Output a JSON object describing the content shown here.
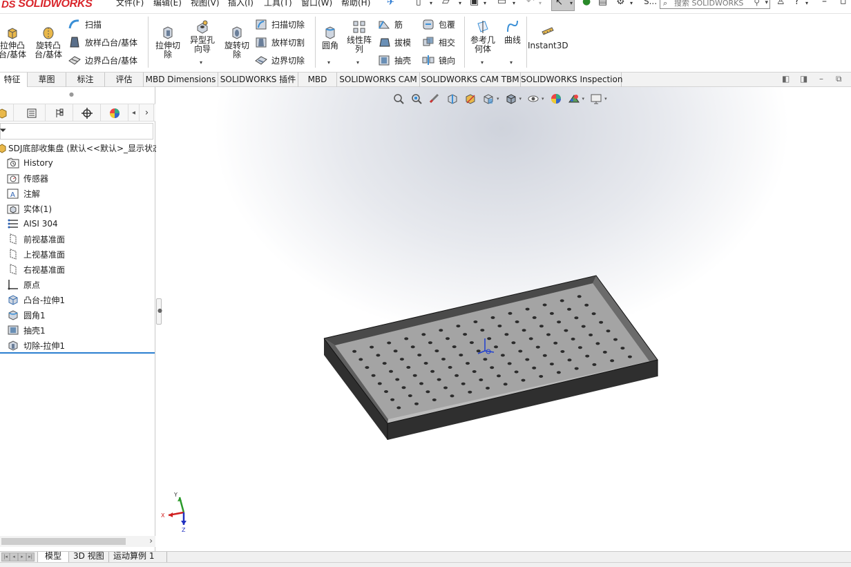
{
  "app": {
    "logo_text": "SOLIDWORKS",
    "logo_prefix": "DS"
  },
  "menu": [
    "文件(F)",
    "编辑(E)",
    "视图(V)",
    "插入(I)",
    "工具(T)",
    "窗口(W)",
    "帮助(H)"
  ],
  "search": {
    "placeholder": "搜索 SOLIDWORKS",
    "visible_text": "搜索 SOLIDWORKS"
  },
  "quick_access": {
    "truncated_label": "S..."
  },
  "commands": {
    "extrude_boss": "拉伸凸\n台/基体",
    "revolve_boss": "旋转凸\n台/基体",
    "sweep": "扫描",
    "loft_boss": "放样凸台/基体",
    "boundary_boss": "边界凸台/基体",
    "extrude_cut": "拉伸切\n除",
    "hole_wizard": "异型孔\n向导",
    "revolve_cut": "旋转切\n除",
    "sweep_cut": "扫描切除",
    "loft_cut": "放样切割",
    "boundary_cut": "边界切除",
    "fillet": "圆角",
    "linear_pattern": "线性阵\n列",
    "rib": "筋",
    "draft": "拔模",
    "shell": "抽壳",
    "wrap": "包覆",
    "intersect": "相交",
    "mirror": "镜向",
    "ref_geometry": "参考几\n何体",
    "curves": "曲线",
    "instant3d": "Instant3D"
  },
  "tabs": [
    "特征",
    "草图",
    "标注",
    "评估",
    "MBD Dimensions",
    "SOLIDWORKS 插件",
    "MBD",
    "SOLIDWORKS CAM",
    "SOLIDWORKS CAM TBM",
    "SOLIDWORKS Inspection"
  ],
  "active_tab": "特征",
  "tree": {
    "root": "SDJ底部收集盘 (默认<<默认>_显示状态",
    "items": [
      {
        "label": "History",
        "icon": "history-folder-icon"
      },
      {
        "label": "传感器",
        "icon": "sensor-icon"
      },
      {
        "label": "注解",
        "icon": "annotation-icon"
      },
      {
        "label": "实体(1)",
        "icon": "solid-bodies-icon"
      },
      {
        "label": "AISI 304",
        "icon": "material-icon"
      },
      {
        "label": "前视基准面",
        "icon": "plane-icon"
      },
      {
        "label": "上视基准面",
        "icon": "plane-icon"
      },
      {
        "label": "右视基准面",
        "icon": "plane-icon"
      },
      {
        "label": "原点",
        "icon": "origin-icon"
      },
      {
        "label": "凸台-拉伸1",
        "icon": "extrude-feature-icon"
      },
      {
        "label": "圆角1",
        "icon": "fillet-feature-icon"
      },
      {
        "label": "抽壳1",
        "icon": "shell-feature-icon"
      },
      {
        "label": "切除-拉伸1",
        "icon": "cut-extrude-feature-icon"
      }
    ]
  },
  "triad": {
    "x": "X",
    "y": "Y",
    "z": "Z"
  },
  "bottom_tabs": [
    "模型",
    "3D 视图",
    "运动算例 1"
  ],
  "active_bottom_tab": "模型",
  "colors": {
    "accent": "#2b7fd0",
    "brand_red": "#d9262c",
    "tray_top": "#a5a5a5",
    "tray_wall": "#2f2f2f"
  }
}
